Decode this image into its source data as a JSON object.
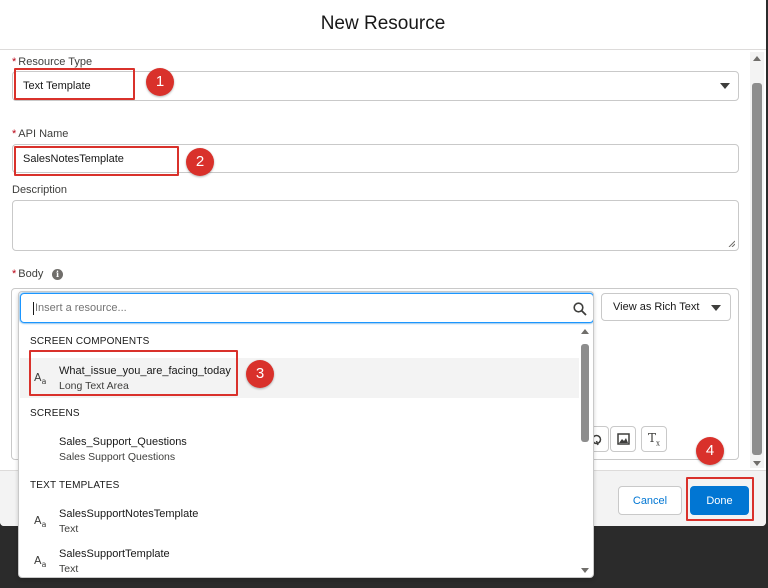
{
  "modal": {
    "title": "New Resource"
  },
  "resource_type": {
    "label": "Resource Type",
    "required_marker": "*",
    "value": "Text Template"
  },
  "api_name": {
    "label": "API Name",
    "required_marker": "*",
    "value": "SalesNotesTemplate"
  },
  "description": {
    "label": "Description",
    "value": ""
  },
  "body": {
    "label": "Body",
    "required_marker": "*",
    "info_icon": "info-icon",
    "view_mode": "View as Rich Text",
    "toolbar_icons": [
      "link-icon",
      "image-icon",
      "clear-formatting-icon"
    ]
  },
  "resource_picker": {
    "placeholder": "Insert a resource...",
    "sections": [
      {
        "header": "SCREEN COMPONENTS",
        "items": [
          {
            "icon": "text-icon",
            "title": "What_issue_you_are_facing_today",
            "subtitle": "Long Text Area",
            "highlighted": true
          }
        ]
      },
      {
        "header": "SCREENS",
        "items": [
          {
            "icon": "",
            "title": "Sales_Support_Questions",
            "subtitle": "Sales Support Questions"
          }
        ]
      },
      {
        "header": "TEXT TEMPLATES",
        "items": [
          {
            "icon": "text-icon",
            "title": "SalesSupportNotesTemplate",
            "subtitle": "Text"
          },
          {
            "icon": "text-icon",
            "title": "SalesSupportTemplate",
            "subtitle": "Text"
          }
        ]
      }
    ]
  },
  "footer": {
    "cancel_label": "Cancel",
    "done_label": "Done"
  },
  "callouts": [
    "1",
    "2",
    "3",
    "4"
  ],
  "colors": {
    "brand": "#0176d3",
    "callout": "#d9312b",
    "required": "#ba0517"
  }
}
